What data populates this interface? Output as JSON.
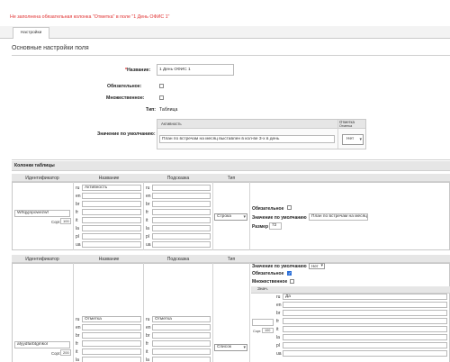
{
  "error_message": "Не заполнена обязательная колонка \"Отметка\" в поле \"1 День ОФИС 1\"",
  "tabs": [
    {
      "label": "Настройки"
    }
  ],
  "section_title": "Основные настройки поля",
  "form": {
    "name_label": "Название:",
    "name_value": "1 День ОФИС 1",
    "required_label": "Обязательное:",
    "multiple_label": "Множественное:",
    "type_label": "Тип:",
    "type_value": "Таблица",
    "default_label": "Значение по умолчанию:",
    "default_table": {
      "col1_header": "Активность",
      "col2_header": "Отметка",
      "col2_sub": "Отметка",
      "row_value": "План по встречам на месяц выставлен в кол-ве 3-х в день",
      "row_select": "Нет"
    }
  },
  "columns_section": {
    "title": "Колонки таблицы",
    "headers": [
      "Идентификатор",
      "Название",
      "Подсказка",
      "Тип"
    ],
    "langs": [
      "ru",
      "en",
      "br",
      "fr",
      "it",
      "la",
      "pl",
      "ua"
    ],
    "rows": [
      {
        "identifier": "Wrfqyjnpowezwf",
        "sort_label": "Сорт.",
        "sort_value": "100",
        "name_ru": "Активность",
        "type": "Строка",
        "required_label": "Обязательное",
        "default_label": "Значение по умолчанию",
        "default_value": "План по встречам на месяц",
        "size_label": "Размер",
        "size_value": "72"
      },
      {
        "identifier": "afyydfarbtgmkol",
        "sort_label": "Сорт.",
        "sort_value": "200",
        "name_ru": "Отметка",
        "hint_ru": "Отметка",
        "type": "Список",
        "default_label": "Значение по умолчанию",
        "default_value": "Нет",
        "required_label": "Обязательное",
        "multiple_label": "Множественное",
        "values_header": "Знач.",
        "values_sort_label": "Сорт.",
        "values_sort_value": "100",
        "value_ru": "Да"
      }
    ]
  }
}
